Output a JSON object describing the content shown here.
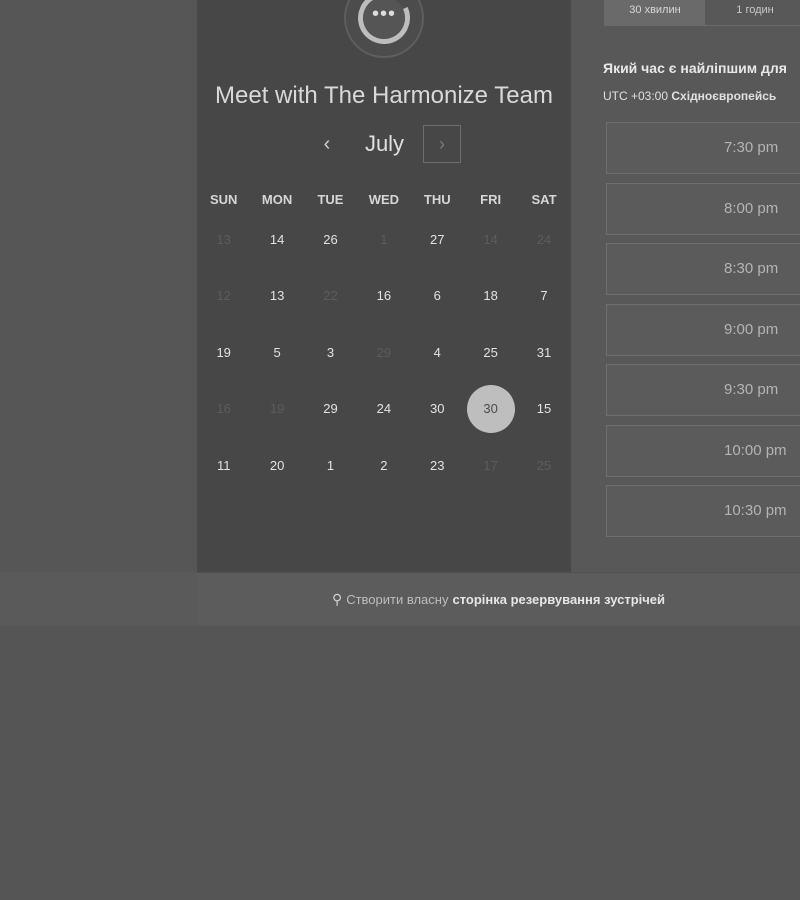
{
  "calendar": {
    "title": "Meet with The Harmonize Team",
    "avatar_icon": "ellipsis-icon",
    "month": "July",
    "prev_label": "‹",
    "next_label": "›",
    "weekdays": [
      "SUN",
      "MON",
      "TUE",
      "WED",
      "THU",
      "FRI",
      "SAT"
    ],
    "weeks": [
      [
        {
          "d": "13",
          "dim": true
        },
        {
          "d": "14",
          "dim": false
        },
        {
          "d": "26",
          "dim": false
        },
        {
          "d": "1",
          "dim": true
        },
        {
          "d": "27",
          "dim": false
        },
        {
          "d": "14",
          "dim": true
        },
        {
          "d": "24",
          "dim": true
        }
      ],
      [
        {
          "d": "12",
          "dim": true
        },
        {
          "d": "13",
          "dim": false
        },
        {
          "d": "22",
          "dim": true
        },
        {
          "d": "16",
          "dim": false
        },
        {
          "d": "6",
          "dim": false
        },
        {
          "d": "18",
          "dim": false
        },
        {
          "d": "7",
          "dim": false
        }
      ],
      [
        {
          "d": "19",
          "dim": false
        },
        {
          "d": "5",
          "dim": false
        },
        {
          "d": "3",
          "dim": false
        },
        {
          "d": "29",
          "dim": true
        },
        {
          "d": "4",
          "dim": false
        },
        {
          "d": "25",
          "dim": false
        },
        {
          "d": "31",
          "dim": false
        }
      ],
      [
        {
          "d": "16",
          "dim": true
        },
        {
          "d": "19",
          "dim": true
        },
        {
          "d": "29",
          "dim": false
        },
        {
          "d": "24",
          "dim": false
        },
        {
          "d": "30",
          "dim": false
        },
        {
          "d": "30",
          "dim": false,
          "selected": true
        },
        {
          "d": "15",
          "dim": false
        }
      ],
      [
        {
          "d": "11",
          "dim": false
        },
        {
          "d": "20",
          "dim": false
        },
        {
          "d": "1",
          "dim": false
        },
        {
          "d": "2",
          "dim": false
        },
        {
          "d": "23",
          "dim": false
        },
        {
          "d": "17",
          "dim": true
        },
        {
          "d": "25",
          "dim": true
        }
      ]
    ]
  },
  "scheduler": {
    "duration_tabs": [
      "30 хвилин",
      "1 годин"
    ],
    "active_duration": 0,
    "question": "Який час є найліпшим для",
    "timezone_prefix": "UTC +03:00",
    "timezone_name": "Східноєвропейсь",
    "slots": [
      "7:30 pm",
      "8:00 pm",
      "8:30 pm",
      "9:00 pm",
      "9:30 pm",
      "10:00 pm",
      "10:30 pm"
    ]
  },
  "footer": {
    "prefix": "Створити власну",
    "link": "сторінка резервування зустрічей",
    "icon": "hubspot-sprocket-icon"
  }
}
